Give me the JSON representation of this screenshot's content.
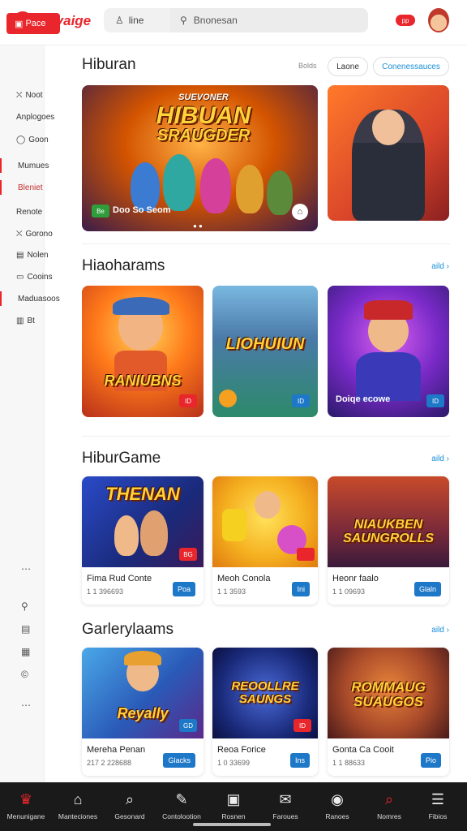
{
  "header": {
    "logo_text": "Noyaige",
    "user_label": "line",
    "search_placeholder": "Bnonesan",
    "notification_badge": "pp"
  },
  "sidebar": {
    "active_item": "Pace",
    "items": [
      {
        "label": "Noot",
        "icon": "⛌"
      },
      {
        "label": "Anplogoes",
        "icon": ""
      },
      {
        "label": "Goon",
        "icon": "◯"
      },
      {
        "label": "Mumues",
        "icon": ""
      },
      {
        "label": "Bleniet",
        "icon": ""
      },
      {
        "label": "Renote",
        "icon": ""
      },
      {
        "label": "Gorono",
        "icon": "⛌"
      },
      {
        "label": "Nolen",
        "icon": "▤"
      },
      {
        "label": "Cooins",
        "icon": "▭"
      },
      {
        "label": "Maduasoos",
        "icon": ""
      },
      {
        "label": "Bt",
        "icon": "▥"
      }
    ],
    "bottom_icons": [
      "⋯",
      "⚲",
      "▤",
      "▦",
      "©",
      "⋯"
    ]
  },
  "section1": {
    "title": "Hiburan",
    "small_label": "Bolds",
    "pill1": "Laone",
    "pill2": "Conenessauces",
    "hero_banner_title_top": "SUEVONER",
    "hero_banner_title_main": "HIBUAN",
    "hero_banner_title_sub": "SRAUGDER",
    "hero_banner_badge": "Be",
    "hero_banner_caption": "Doo So Seom"
  },
  "section2": {
    "title": "Hiaoharams",
    "more": "aild",
    "tiles": [
      {
        "title": "RANIUBNS",
        "badge": "ID"
      },
      {
        "title": "LIOHUIUN",
        "badge": "ID"
      },
      {
        "title": "Doiqe ecowe",
        "badge": "ID"
      }
    ]
  },
  "section3": {
    "title": "HiburGame",
    "more": "aild",
    "cards": [
      {
        "art_title": "THENAN",
        "badge": "BG",
        "name": "Fima Rud Conte",
        "meta": "1 1 396693",
        "button": "Poa"
      },
      {
        "art_title": "",
        "badge": "",
        "name": "Meoh Conola",
        "meta": "1 1 3593",
        "button": "Ini"
      },
      {
        "art_title": "NIAUKBEN SAUNGROLLS",
        "badge": "",
        "name": "Heonr faalo",
        "meta": "1 1 09693",
        "button": "Glaln"
      }
    ]
  },
  "section4": {
    "title": "Garlerylaams",
    "more": "aild",
    "cards": [
      {
        "art_title": "Reyally",
        "badge": "GD",
        "name": "Mereha Penan",
        "meta": "217 2 228688",
        "button": "Glacks"
      },
      {
        "art_title": "REOOLLRE SAUNGS",
        "badge": "ID",
        "name": "Reoa Forice",
        "meta": "1 0 33699",
        "button": "Ins"
      },
      {
        "art_title": "ROMMAUG SUAUGOS",
        "badge": "",
        "name": "Gonta Ca Cooit",
        "meta": "1 1 88633",
        "button": "Pio"
      }
    ]
  },
  "bottomnav": {
    "items": [
      {
        "label": "Menunigane",
        "icon": "♛"
      },
      {
        "label": "Manteciones",
        "icon": "⌂"
      },
      {
        "label": "Gesonard",
        "icon": "⌕"
      },
      {
        "label": "Contolootion",
        "icon": "✎"
      },
      {
        "label": "Rosnen",
        "icon": "▣"
      },
      {
        "label": "Faroues",
        "icon": "✉"
      },
      {
        "label": "Ranoes",
        "icon": "◉"
      },
      {
        "label": "Nomres",
        "icon": "⌕"
      },
      {
        "label": "Fibios",
        "icon": "☰"
      }
    ]
  },
  "colors": {
    "accent": "#e8262c",
    "link": "#1a8fd8",
    "button": "#1e78c8",
    "nav_bg": "#1a1a1a"
  }
}
